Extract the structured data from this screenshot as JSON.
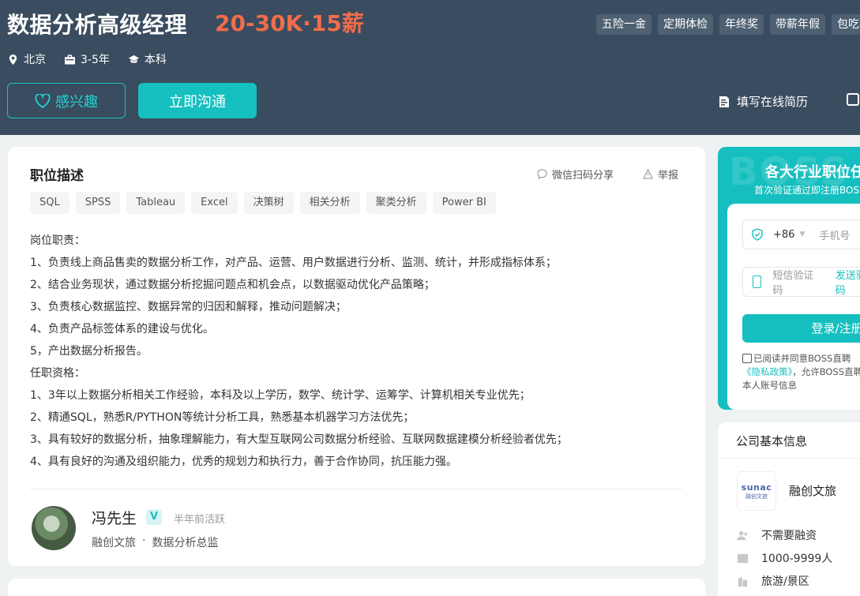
{
  "header": {
    "job_title": "数据分析高级经理",
    "salary": "20-30K·15薪",
    "benefits": [
      "五险一金",
      "定期体检",
      "年终奖",
      "带薪年假",
      "包吃"
    ],
    "location": "北京",
    "experience": "3-5年",
    "education": "本科",
    "like_button": "感兴趣",
    "chat_button": "立即沟通",
    "resume_link": "填写在线简历"
  },
  "description": {
    "title": "职位描述",
    "share_label": "微信扫码分享",
    "report_label": "举报",
    "tags": [
      "SQL",
      "SPSS",
      "Tableau",
      "Excel",
      "决策树",
      "相关分析",
      "聚类分析",
      "Power BI"
    ],
    "lines": [
      "岗位职责：",
      "1、负责线上商品售卖的数据分析工作，对产品、运营、用户数据进行分析、监测、统计，并形成指标体系；",
      "2、结合业务现状，通过数据分析挖掘问题点和机会点，以数据驱动优化产品策略；",
      "3、负责核心数据监控、数据异常的归因和解释，推动问题解决；",
      "4、负责产品标签体系的建设与优化。",
      "5，产出数据分析报告。",
      "任职资格：",
      "1、3年以上数据分析相关工作经验，本科及以上学历，数学、统计学、运筹学、计算机相关专业优先；",
      "2、精通SQL，熟悉R/PYTHON等统计分析工具，熟悉基本机器学习方法优先；",
      "3、具有较好的数据分析，抽象理解能力，有大型互联网公司数据分析经验、互联网数据建模分析经验者优先；",
      "4、具有良好的沟通及组织能力，优秀的规划力和执行力，善于合作协同，抗压能力强。"
    ]
  },
  "recruiter": {
    "name": "冯先生",
    "verified_mark": "V",
    "active_status": "半年前活跃",
    "company": "融创文旅",
    "separator": "·",
    "position": "数据分析总监"
  },
  "login": {
    "watermark": "BOSS",
    "title": "各大行业职位任你选",
    "subtitle": "首次验证通过即注册BOSS直聘账号",
    "country_code": "+86",
    "phone_placeholder": "手机号",
    "code_placeholder": "短信验证码",
    "send_code": "发送验证码",
    "button": "登录/注册",
    "agree_text": "已阅读并同意BOSS直聘",
    "privacy_link": "《隐私政策》",
    "agree_text2": "，允许BOSS直聘统一管理",
    "agree_text3": "本人账号信息"
  },
  "company": {
    "section_title": "公司基本信息",
    "logo_text": "sunac",
    "logo_sub": "融创文旅",
    "name": "融创文旅",
    "financing": "不需要融资",
    "size": "1000-9999人",
    "industry": "旅游/景区"
  }
}
